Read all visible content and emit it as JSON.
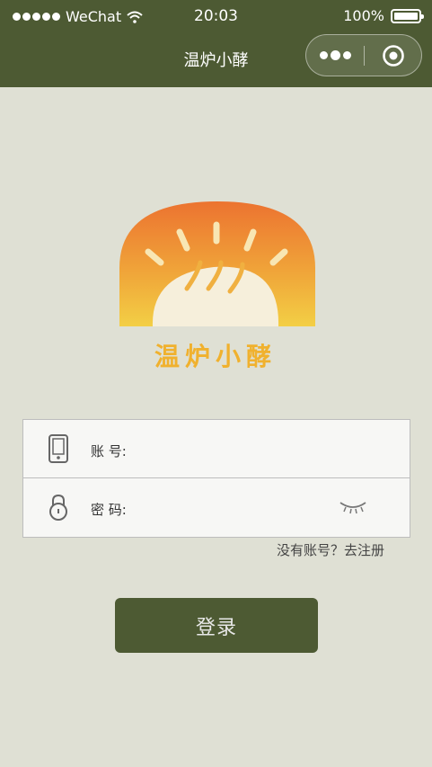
{
  "status_bar": {
    "carrier": "WeChat",
    "time": "20:03",
    "battery": "100%"
  },
  "nav": {
    "title": "温炉小酵"
  },
  "logo": {
    "text": "温炉小酵",
    "colors": {
      "top": "#ee7a2f",
      "bottom": "#f2c842",
      "bread": "#f6f0dc",
      "text": "#f0b12e"
    }
  },
  "form": {
    "account_label": "账 号:",
    "account_value": "",
    "password_label": "密 码:",
    "password_value": ""
  },
  "register_link": "没有账号？去注册",
  "login_button": "登录",
  "colors": {
    "header": "#4d5a33",
    "background": "#dfe0d4",
    "button": "#4d5a33"
  }
}
